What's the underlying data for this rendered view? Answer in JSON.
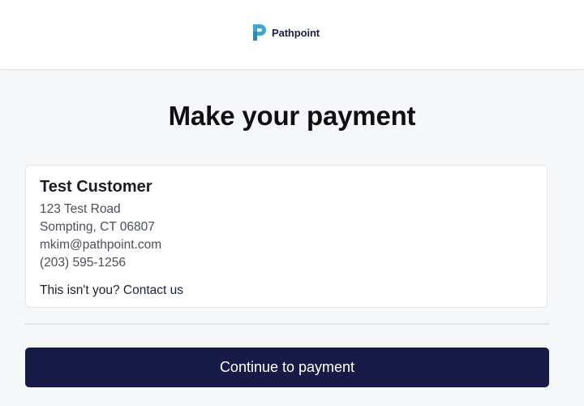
{
  "header": {
    "brand_name": "Pathpoint",
    "logo_icon": "pathpoint-logo-icon",
    "brand_color": "#3aa8d8"
  },
  "main": {
    "title": "Make your payment"
  },
  "customer": {
    "name": "Test Customer",
    "address_line1": "123 Test Road",
    "address_line2": "Sompting, CT 06807",
    "email": "mkim@pathpoint.com",
    "phone": "(203) 595-1256",
    "not_you_text": "This isn't you?",
    "contact_link": "Contact us"
  },
  "actions": {
    "continue_label": "Continue to payment",
    "button_color": "#191b47"
  }
}
